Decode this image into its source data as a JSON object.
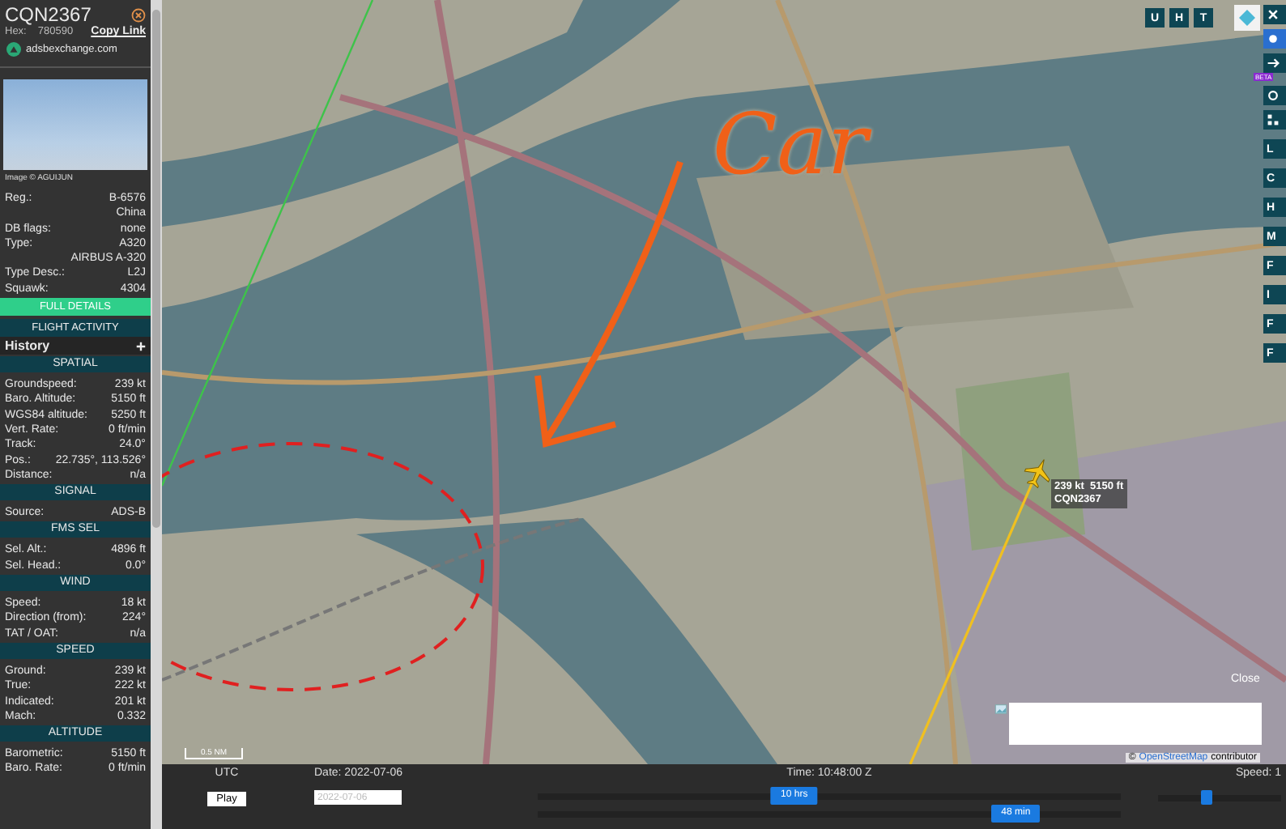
{
  "aircraft": {
    "callsign": "CQN2367",
    "hex_label": "Hex:",
    "hex": "780590",
    "copy_link": "Copy Link",
    "source_site": "adsbexchange.com",
    "photo_credit": "Image © AGUIJUN"
  },
  "details": [
    {
      "label": "Reg.:",
      "values": [
        "B-6576",
        "China"
      ]
    },
    {
      "label": "DB flags:",
      "values": [
        "none"
      ]
    },
    {
      "label": "Type:",
      "values": [
        "A320",
        "AIRBUS A-320"
      ]
    },
    {
      "label": "Type Desc.:",
      "values": [
        "L2J"
      ]
    },
    {
      "label": "Squawk:",
      "values": [
        "4304"
      ]
    }
  ],
  "full_details": "FULL DETAILS",
  "flight_activity": "FLIGHT ACTIVITY",
  "history": "History",
  "sections": [
    {
      "title": "SPATIAL",
      "rows": [
        {
          "label": "Groundspeed:",
          "value": "239 kt"
        },
        {
          "label": "Baro. Altitude:",
          "value": "5150 ft"
        },
        {
          "label": "WGS84 altitude:",
          "value": "5250 ft"
        },
        {
          "label": "Vert. Rate:",
          "value": "0 ft/min"
        },
        {
          "label": "Track:",
          "value": "24.0°"
        },
        {
          "label": "Pos.:",
          "value": "22.735°, 113.526°"
        },
        {
          "label": "Distance:",
          "value": "n/a"
        }
      ]
    },
    {
      "title": "SIGNAL",
      "rows": [
        {
          "label": "Source:",
          "value": "ADS-B"
        }
      ]
    },
    {
      "title": "FMS SEL",
      "rows": [
        {
          "label": "Sel. Alt.:",
          "value": "4896 ft"
        },
        {
          "label": "Sel. Head.:",
          "value": "0.0°"
        }
      ]
    },
    {
      "title": "WIND",
      "rows": [
        {
          "label": "Speed:",
          "value": "18 kt"
        },
        {
          "label": "Direction (from):",
          "value": "224°"
        },
        {
          "label": "TAT / OAT:",
          "value": "n/a"
        }
      ]
    },
    {
      "title": "SPEED",
      "rows": [
        {
          "label": "Ground:",
          "value": "239 kt"
        },
        {
          "label": "True:",
          "value": "222 kt"
        },
        {
          "label": "Indicated:",
          "value": "201 kt"
        },
        {
          "label": "Mach:",
          "value": "0.332"
        }
      ]
    },
    {
      "title": "ALTITUDE",
      "rows": [
        {
          "label": "Barometric:",
          "value": "5150 ft"
        },
        {
          "label": "Baro. Rate:",
          "value": "0 ft/min"
        }
      ]
    }
  ],
  "map": {
    "aircraft_label": [
      "239 kt  5150 ft",
      "CQN2367"
    ],
    "annotation": "Car",
    "close": "Close",
    "attribution_prefix": "©",
    "attribution_link": "OpenStreetMap",
    "attribution_rest": "contributor",
    "scale": "0.5 NM",
    "beta": "BETA"
  },
  "map_buttons": [
    "U",
    "H",
    "T"
  ],
  "side_buttons": [
    "L",
    "C",
    "H",
    "M",
    "F",
    "I",
    "F",
    "F"
  ],
  "playback": {
    "timezone": "UTC",
    "date_label": "Date: 2022-07-06",
    "time_label": "Time: 10:48:00 Z",
    "speed_label": "Speed: 1",
    "play": "Play",
    "date_placeholder": "2022-07-06",
    "hours": {
      "label": "10 hrs",
      "level": 0.44
    },
    "minutes": {
      "label": "48 min",
      "level": 0.82
    },
    "speed": {
      "level": 0.4
    }
  }
}
